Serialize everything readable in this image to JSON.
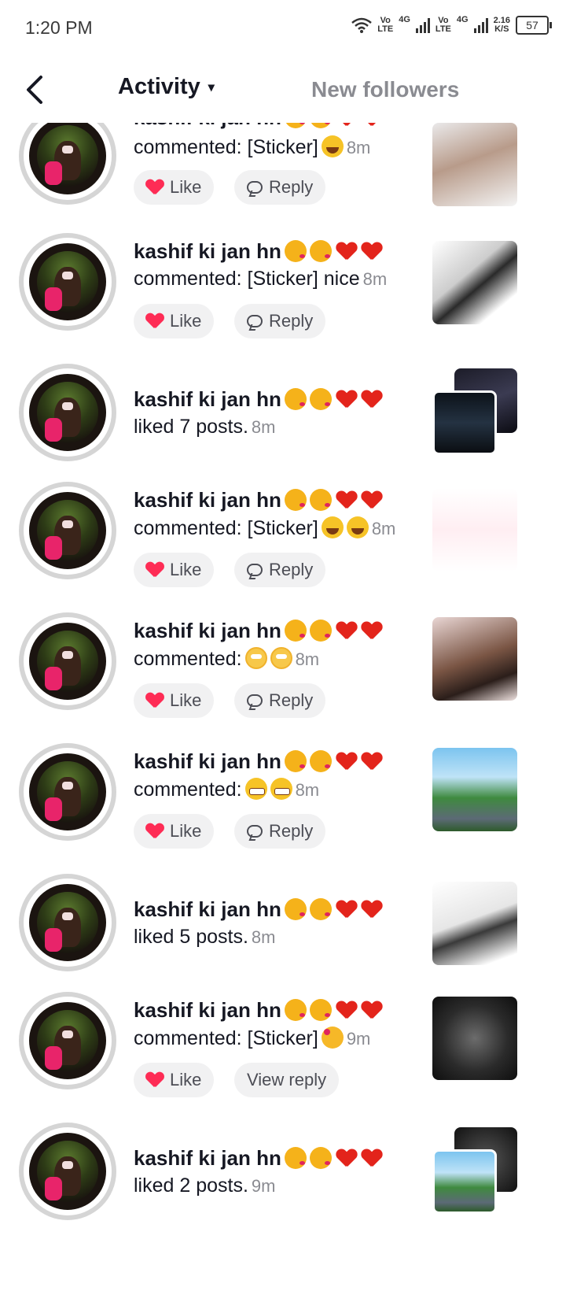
{
  "status_bar": {
    "time": "1:20 PM",
    "vo1": "Vo",
    "lte1": "LTE",
    "net1": "4G",
    "vo2": "Vo",
    "lte2": "LTE",
    "net2": "4G",
    "speed": "2.16",
    "speed_unit": "K/S",
    "battery": "57"
  },
  "header": {
    "activity_label": "Activity",
    "activity_caret": "▾",
    "new_followers_label": "New followers"
  },
  "items": [
    {
      "name": "kashif ki jan hn",
      "action": "commented: [Sticker]",
      "time": "8m",
      "like": "Like",
      "reply": "Reply"
    },
    {
      "name": "kashif ki jan hn",
      "action": "commented: [Sticker] nice",
      "time": "8m",
      "like": "Like",
      "reply": "Reply"
    },
    {
      "name": "kashif ki jan hn",
      "action": "liked 7 posts.",
      "time": "8m"
    },
    {
      "name": "kashif ki jan hn",
      "action": "commented: [Sticker]",
      "time": "8m",
      "like": "Like",
      "reply": "Reply"
    },
    {
      "name": "kashif ki jan hn",
      "action": "commented:",
      "time": "8m",
      "like": "Like",
      "reply": "Reply"
    },
    {
      "name": "kashif ki jan hn",
      "action": "commented:",
      "time": "8m",
      "like": "Like",
      "reply": "Reply"
    },
    {
      "name": "kashif ki jan hn",
      "action": "liked 5 posts.",
      "time": "8m"
    },
    {
      "name": "kashif ki jan hn",
      "action": "commented: [Sticker]",
      "time": "9m",
      "like": "Like",
      "reply": "View reply"
    },
    {
      "name": "kashif ki jan hn",
      "action": "liked 2 posts.",
      "time": "9m"
    }
  ],
  "colors": {
    "like_heart": "#fe2c55",
    "muted_text": "#8a8b91",
    "button_bg": "#f1f1f2"
  }
}
